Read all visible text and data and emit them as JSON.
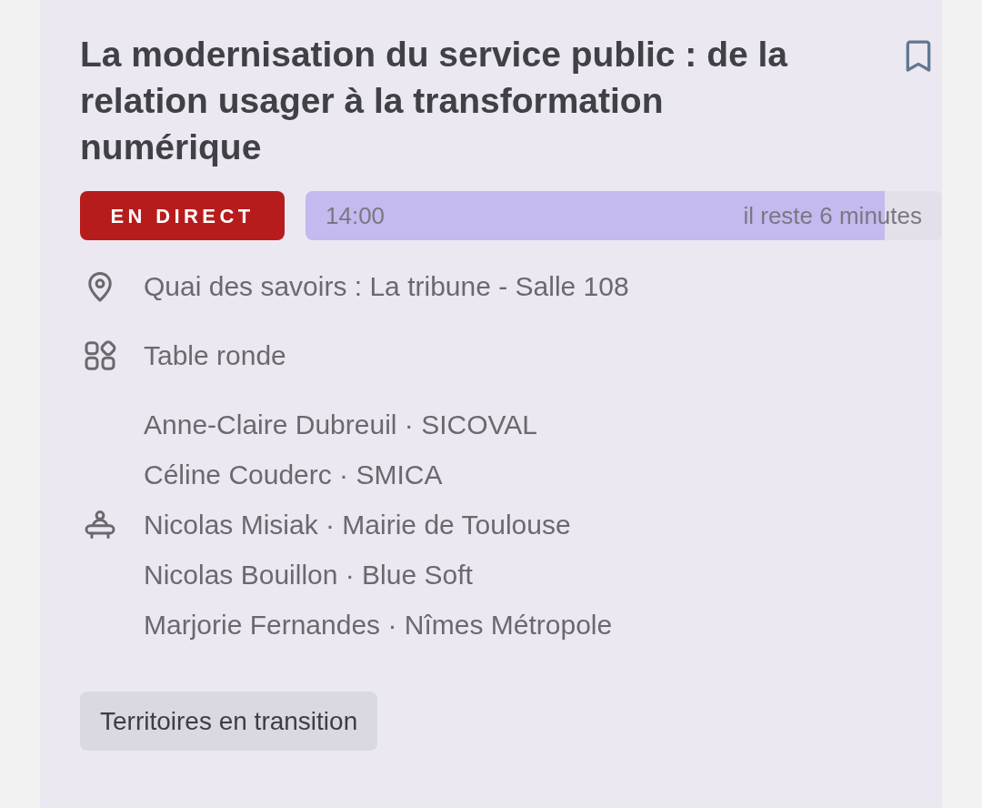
{
  "session": {
    "title": "La modernisation du service public : de la relation usager à la transformation numérique",
    "bookmarked": false
  },
  "status": {
    "badge": "EN DIRECT",
    "start_time": "14:00",
    "remaining": "il reste 6 minutes",
    "level": 0.91
  },
  "details": [
    {
      "kind": "location",
      "lines": [
        "Quai des savoirs : La tribune - Salle 108"
      ]
    },
    {
      "kind": "format",
      "lines": [
        "Table ronde"
      ]
    },
    {
      "kind": "speakers",
      "lines": [
        "Anne-Claire Dubreuil · SICOVAL",
        "Céline Couderc · SMICA",
        "Nicolas Misiak · Mairie de Toulouse",
        "Nicolas Bouillon · Blue Soft",
        "Marjorie Fernandes · Nîmes Métropole"
      ]
    }
  ],
  "tags": [
    {
      "label": "Territoires en transition"
    }
  ]
}
